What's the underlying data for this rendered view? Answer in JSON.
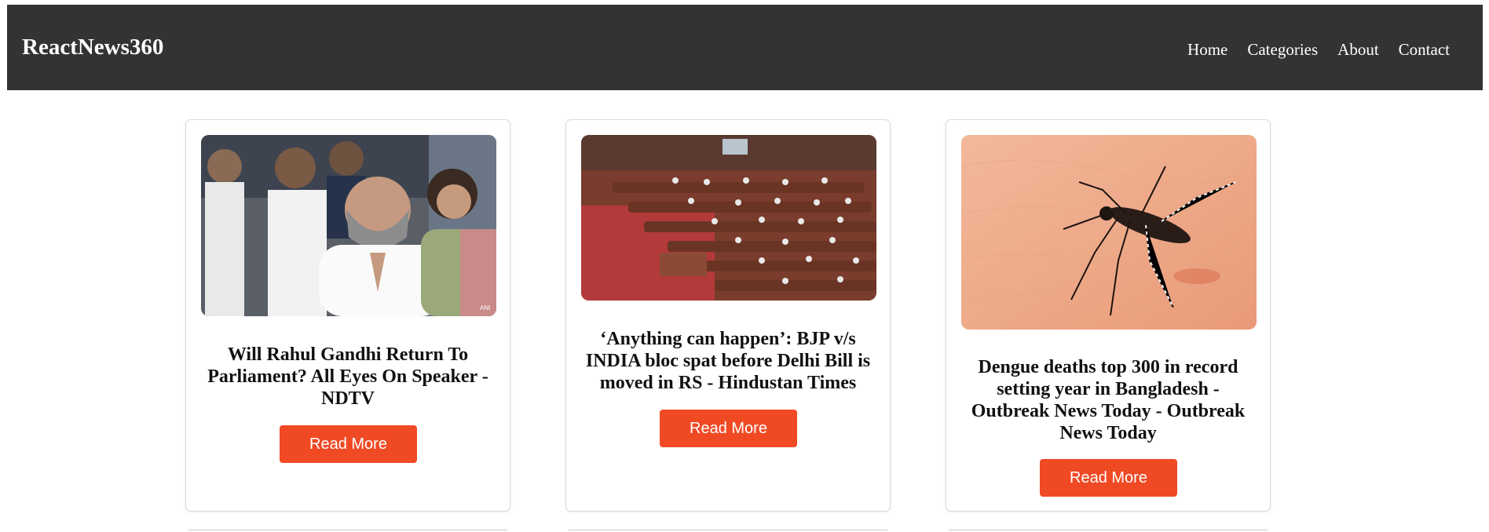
{
  "header": {
    "brand": "ReactNews360",
    "nav": [
      {
        "label": "Home"
      },
      {
        "label": "Categories"
      },
      {
        "label": "About"
      },
      {
        "label": "Contact"
      }
    ]
  },
  "articles": [
    {
      "title": "Will Rahul Gandhi Return To Parliament? All Eyes On Speaker - NDTV",
      "button_label": "Read More",
      "image_caption": "ANI"
    },
    {
      "title": "‘Anything can happen’: BJP v/s INDIA bloc spat before Delhi Bill is moved in RS - Hindustan Times",
      "button_label": "Read More"
    },
    {
      "title": "Dengue deaths top 300 in record setting year in Bangladesh - Outbreak News Today - Outbreak News Today",
      "button_label": "Read More"
    }
  ],
  "colors": {
    "navbar_bg": "#333333",
    "button_bg": "#f04a25",
    "button_text": "#ffffff"
  }
}
